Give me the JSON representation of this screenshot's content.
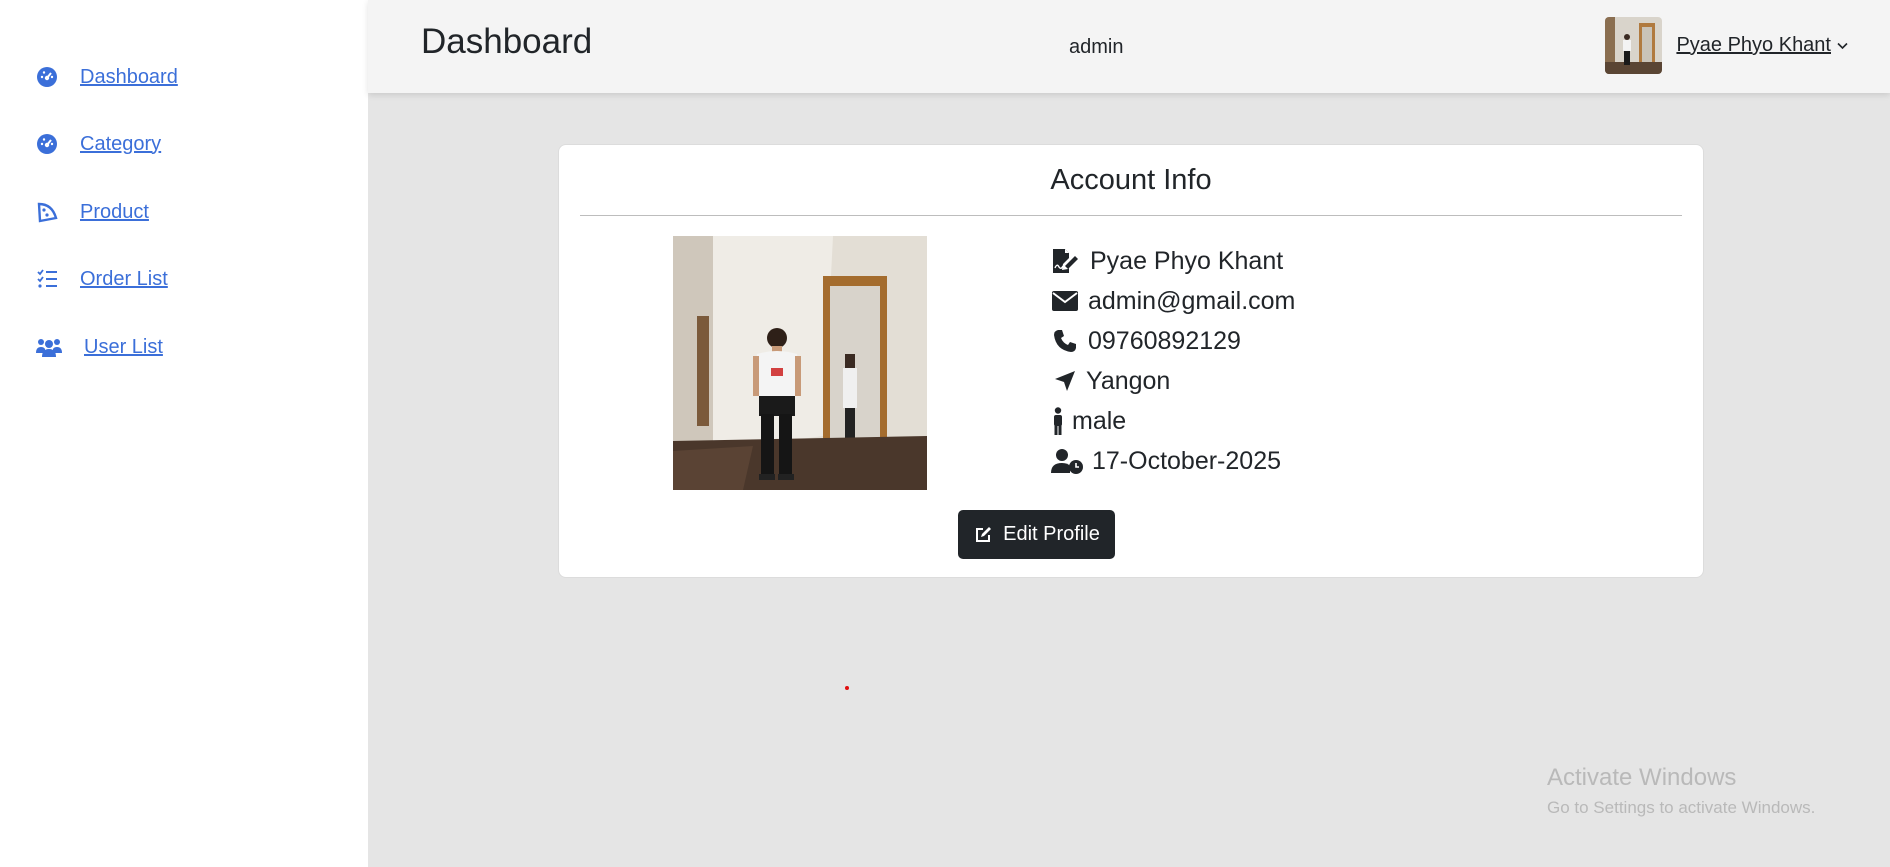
{
  "sidebar": {
    "items": [
      {
        "label": "Dashboard",
        "icon": "gauge-icon"
      },
      {
        "label": "Category",
        "icon": "gauge-icon"
      },
      {
        "label": "Product",
        "icon": "pizza-slice-icon"
      },
      {
        "label": "Order List",
        "icon": "list-check-icon"
      },
      {
        "label": "User List",
        "icon": "users-icon"
      }
    ]
  },
  "header": {
    "title": "Dashboard",
    "role": "admin",
    "user_name": "Pyae Phyo Khant"
  },
  "card": {
    "title": "Account Info",
    "name": "Pyae Phyo Khant",
    "email": "admin@gmail.com",
    "phone": "09760892129",
    "address": "Yangon",
    "gender": "male",
    "joined": "17-October-2025",
    "edit_label": "Edit Profile"
  },
  "watermark": {
    "title": "Activate Windows",
    "subtitle": "Go to Settings to activate Windows."
  },
  "colors": {
    "link": "#3b6fd9",
    "button_bg": "#212529",
    "content_bg": "#e5e5e5"
  }
}
